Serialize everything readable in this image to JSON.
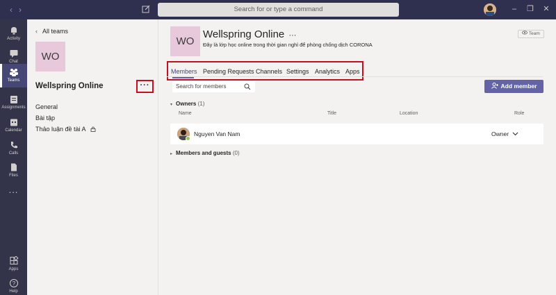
{
  "titlebar": {
    "search_placeholder": "Search for or type a command"
  },
  "rail": {
    "items": [
      {
        "label": "Activity",
        "icon": "bell-icon"
      },
      {
        "label": "Chat",
        "icon": "chat-icon"
      },
      {
        "label": "Teams",
        "icon": "teams-icon"
      },
      {
        "label": "Assignments",
        "icon": "assignments-icon"
      },
      {
        "label": "Calendar",
        "icon": "calendar-icon"
      },
      {
        "label": "Calls",
        "icon": "phone-icon"
      },
      {
        "label": "Files",
        "icon": "file-icon"
      },
      {
        "label": "Apps",
        "icon": "apps-icon"
      },
      {
        "label": "Help",
        "icon": "help-icon"
      }
    ],
    "more": "..."
  },
  "left": {
    "back_label": "All teams",
    "team_initials": "WO",
    "team_name": "Wellspring Online",
    "more": "···",
    "channels": [
      "General",
      "Bài tập",
      "Thảo luận đề tài A"
    ]
  },
  "main": {
    "initials": "WO",
    "title": "Wellspring Online",
    "title_more": "···",
    "subtitle": "Đây là lớp học online trong thời gian nghỉ để phòng chống dịch CORONA",
    "badge": "Team",
    "tabs": [
      "Members",
      "Pending Requests",
      "Channels",
      "Settings",
      "Analytics",
      "Apps"
    ],
    "search_placeholder": "Search for members",
    "add_member": "Add member",
    "owners_label": "Owners",
    "owners_count": "(1)",
    "columns": [
      "Name",
      "Title",
      "Location",
      "Role"
    ],
    "members": [
      {
        "name": "Nguyen Van Nam",
        "role": "Owner"
      }
    ],
    "guests_label": "Members and guests",
    "guests_count": "(0)"
  },
  "colors": {
    "accent": "#6264a7",
    "rail": "#33344a",
    "highlight_box": "#c50f1f"
  }
}
